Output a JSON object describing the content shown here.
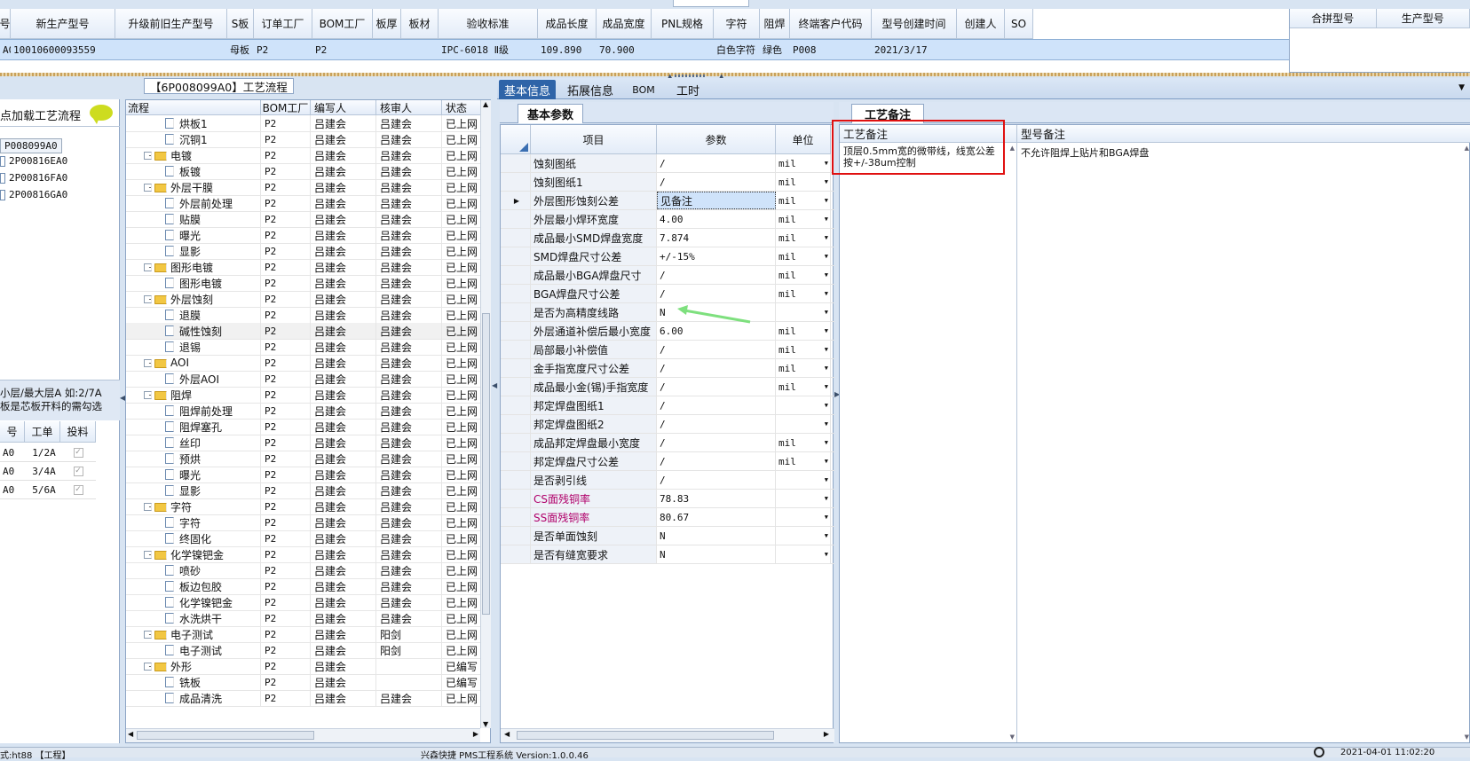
{
  "top_grid": {
    "headers": [
      "号",
      "新生产型号",
      "升级前旧生产型号",
      "S板",
      "订单工厂",
      "BOM工厂",
      "板厚",
      "板材",
      "验收标准",
      "成品长度",
      "成品宽度",
      "PNL规格",
      "字符",
      "阻焊",
      "终端客户代码",
      "型号创建时间",
      "创建人",
      "SO"
    ],
    "row": [
      "A0",
      "10010600093559",
      "",
      "母板",
      "P2",
      "P2",
      "",
      "",
      "IPC-6018 Ⅱ级",
      "109.890",
      "70.900",
      "",
      "白色字符",
      "绿色",
      "P008",
      "2021/3/17",
      "",
      ""
    ],
    "merge_headers": [
      "合拼型号",
      "生产型号"
    ]
  },
  "left_panel": {
    "load_text": "点加载工艺流程",
    "tree": [
      "P008099A0",
      "2P00816EA0",
      "2P00816FA0",
      "2P00816GA0"
    ],
    "hint_line1": "小层/最大层A 如:2/7A",
    "hint_line2": "板是芯板开料的需勾选",
    "grid_headers": [
      "号",
      "工单",
      "投料"
    ],
    "grid_rows": [
      [
        "A0",
        "1/2A"
      ],
      [
        "A0",
        "3/4A"
      ],
      [
        "A0",
        "5/6A"
      ]
    ]
  },
  "process_panel": {
    "title": "【6P008099A0】工艺流程",
    "headers": [
      "流程",
      "BOM工厂",
      "编写人",
      "核审人",
      "状态"
    ],
    "rows": [
      {
        "name": "烘板1",
        "lvl": 1,
        "f": 0,
        "bom": "P2",
        "w": "吕建会",
        "r": "吕建会",
        "s": "已上网"
      },
      {
        "name": "沉铜1",
        "lvl": 1,
        "f": 0,
        "bom": "P2",
        "w": "吕建会",
        "r": "吕建会",
        "s": "已上网"
      },
      {
        "name": "电镀",
        "lvl": 0,
        "f": 1,
        "bom": "P2",
        "w": "吕建会",
        "r": "吕建会",
        "s": "已上网"
      },
      {
        "name": "板镀",
        "lvl": 1,
        "f": 0,
        "bom": "P2",
        "w": "吕建会",
        "r": "吕建会",
        "s": "已上网"
      },
      {
        "name": "外层干膜",
        "lvl": 0,
        "f": 1,
        "bom": "P2",
        "w": "吕建会",
        "r": "吕建会",
        "s": "已上网"
      },
      {
        "name": "外层前处理",
        "lvl": 1,
        "f": 0,
        "bom": "P2",
        "w": "吕建会",
        "r": "吕建会",
        "s": "已上网"
      },
      {
        "name": "贴膜",
        "lvl": 1,
        "f": 0,
        "bom": "P2",
        "w": "吕建会",
        "r": "吕建会",
        "s": "已上网"
      },
      {
        "name": "曝光",
        "lvl": 1,
        "f": 0,
        "bom": "P2",
        "w": "吕建会",
        "r": "吕建会",
        "s": "已上网"
      },
      {
        "name": "显影",
        "lvl": 1,
        "f": 0,
        "bom": "P2",
        "w": "吕建会",
        "r": "吕建会",
        "s": "已上网"
      },
      {
        "name": "图形电镀",
        "lvl": 0,
        "f": 1,
        "bom": "P2",
        "w": "吕建会",
        "r": "吕建会",
        "s": "已上网"
      },
      {
        "name": "图形电镀",
        "lvl": 1,
        "f": 0,
        "bom": "P2",
        "w": "吕建会",
        "r": "吕建会",
        "s": "已上网"
      },
      {
        "name": "外层蚀刻",
        "lvl": 0,
        "f": 1,
        "bom": "P2",
        "w": "吕建会",
        "r": "吕建会",
        "s": "已上网"
      },
      {
        "name": "退膜",
        "lvl": 1,
        "f": 0,
        "bom": "P2",
        "w": "吕建会",
        "r": "吕建会",
        "s": "已上网"
      },
      {
        "name": "碱性蚀刻",
        "lvl": 1,
        "f": 0,
        "bom": "P2",
        "w": "吕建会",
        "r": "吕建会",
        "s": "已上网"
      },
      {
        "name": "退锡",
        "lvl": 1,
        "f": 0,
        "bom": "P2",
        "w": "吕建会",
        "r": "吕建会",
        "s": "已上网"
      },
      {
        "name": "AOI",
        "lvl": 0,
        "f": 1,
        "bom": "P2",
        "w": "吕建会",
        "r": "吕建会",
        "s": "已上网"
      },
      {
        "name": "外层AOI",
        "lvl": 1,
        "f": 0,
        "bom": "P2",
        "w": "吕建会",
        "r": "吕建会",
        "s": "已上网"
      },
      {
        "name": "阻焊",
        "lvl": 0,
        "f": 1,
        "bom": "P2",
        "w": "吕建会",
        "r": "吕建会",
        "s": "已上网"
      },
      {
        "name": "阻焊前处理",
        "lvl": 1,
        "f": 0,
        "bom": "P2",
        "w": "吕建会",
        "r": "吕建会",
        "s": "已上网"
      },
      {
        "name": "阻焊塞孔",
        "lvl": 1,
        "f": 0,
        "bom": "P2",
        "w": "吕建会",
        "r": "吕建会",
        "s": "已上网"
      },
      {
        "name": "丝印",
        "lvl": 1,
        "f": 0,
        "bom": "P2",
        "w": "吕建会",
        "r": "吕建会",
        "s": "已上网"
      },
      {
        "name": "预烘",
        "lvl": 1,
        "f": 0,
        "bom": "P2",
        "w": "吕建会",
        "r": "吕建会",
        "s": "已上网"
      },
      {
        "name": "曝光",
        "lvl": 1,
        "f": 0,
        "bom": "P2",
        "w": "吕建会",
        "r": "吕建会",
        "s": "已上网"
      },
      {
        "name": "显影",
        "lvl": 1,
        "f": 0,
        "bom": "P2",
        "w": "吕建会",
        "r": "吕建会",
        "s": "已上网"
      },
      {
        "name": "字符",
        "lvl": 0,
        "f": 1,
        "bom": "P2",
        "w": "吕建会",
        "r": "吕建会",
        "s": "已上网"
      },
      {
        "name": "字符",
        "lvl": 1,
        "f": 0,
        "bom": "P2",
        "w": "吕建会",
        "r": "吕建会",
        "s": "已上网"
      },
      {
        "name": "终固化",
        "lvl": 1,
        "f": 0,
        "bom": "P2",
        "w": "吕建会",
        "r": "吕建会",
        "s": "已上网"
      },
      {
        "name": "化学镍钯金",
        "lvl": 0,
        "f": 1,
        "bom": "P2",
        "w": "吕建会",
        "r": "吕建会",
        "s": "已上网"
      },
      {
        "name": "喷砂",
        "lvl": 1,
        "f": 0,
        "bom": "P2",
        "w": "吕建会",
        "r": "吕建会",
        "s": "已上网"
      },
      {
        "name": "板边包胶",
        "lvl": 1,
        "f": 0,
        "bom": "P2",
        "w": "吕建会",
        "r": "吕建会",
        "s": "已上网"
      },
      {
        "name": "化学镍钯金",
        "lvl": 1,
        "f": 0,
        "bom": "P2",
        "w": "吕建会",
        "r": "吕建会",
        "s": "已上网"
      },
      {
        "name": "水洗烘干",
        "lvl": 1,
        "f": 0,
        "bom": "P2",
        "w": "吕建会",
        "r": "吕建会",
        "s": "已上网"
      },
      {
        "name": "电子测试",
        "lvl": 0,
        "f": 1,
        "bom": "P2",
        "w": "吕建会",
        "r": "阳剑",
        "s": "已上网"
      },
      {
        "name": "电子测试",
        "lvl": 1,
        "f": 0,
        "bom": "P2",
        "w": "吕建会",
        "r": "阳剑",
        "s": "已上网"
      },
      {
        "name": "外形",
        "lvl": 0,
        "f": 1,
        "bom": "P2",
        "w": "吕建会",
        "r": "",
        "s": "已编写"
      },
      {
        "name": "铣板",
        "lvl": 1,
        "f": 0,
        "bom": "P2",
        "w": "吕建会",
        "r": "",
        "s": "已编写"
      },
      {
        "name": "成品清洗",
        "lvl": 1,
        "f": 0,
        "bom": "P2",
        "w": "吕建会",
        "r": "吕建会",
        "s": "已上网"
      }
    ]
  },
  "tabs": [
    "基本信息",
    "拓展信息",
    "BOM",
    "工时"
  ],
  "sub_tabs": {
    "basic": "基本参数",
    "notes": "工艺备注"
  },
  "param_grid": {
    "headers": [
      "项目",
      "参数",
      "单位"
    ],
    "rows": [
      {
        "item": "蚀刻图纸",
        "val": "/",
        "unit": "mil",
        "pink": false
      },
      {
        "item": "蚀刻图纸1",
        "val": "/",
        "unit": "mil",
        "pink": false
      },
      {
        "item": "外层图形蚀刻公差",
        "val": "见备注",
        "unit": "mil",
        "pink": false
      },
      {
        "item": "外层最小焊环宽度",
        "val": "4.00",
        "unit": "mil",
        "pink": false
      },
      {
        "item": "成品最小SMD焊盘宽度",
        "val": "7.874",
        "unit": "mil",
        "pink": false
      },
      {
        "item": "SMD焊盘尺寸公差",
        "val": "+/-15%",
        "unit": "mil",
        "pink": false
      },
      {
        "item": "成品最小BGA焊盘尺寸",
        "val": "/",
        "unit": "mil",
        "pink": false
      },
      {
        "item": "BGA焊盘尺寸公差",
        "val": "/",
        "unit": "mil",
        "pink": false
      },
      {
        "item": "是否为高精度线路",
        "val": "N",
        "unit": "",
        "pink": false
      },
      {
        "item": "外层通道补偿后最小宽度",
        "val": "6.00",
        "unit": "mil",
        "pink": false
      },
      {
        "item": "局部最小补偿值",
        "val": "/",
        "unit": "mil",
        "pink": false
      },
      {
        "item": "金手指宽度尺寸公差",
        "val": "/",
        "unit": "mil",
        "pink": false
      },
      {
        "item": "成品最小金(锡)手指宽度",
        "val": "/",
        "unit": "mil",
        "pink": false
      },
      {
        "item": "邦定焊盘图纸1",
        "val": "/",
        "unit": "",
        "pink": false
      },
      {
        "item": "邦定焊盘图纸2",
        "val": "/",
        "unit": "",
        "pink": false
      },
      {
        "item": "成品邦定焊盘最小宽度",
        "val": "/",
        "unit": "mil",
        "pink": false
      },
      {
        "item": "邦定焊盘尺寸公差",
        "val": "/",
        "unit": "mil",
        "pink": false
      },
      {
        "item": "是否剥引线",
        "val": "/",
        "unit": "",
        "pink": false
      },
      {
        "item": "CS面残铜率",
        "val": "78.83",
        "unit": "",
        "pink": true
      },
      {
        "item": "SS面残铜率",
        "val": "80.67",
        "unit": "",
        "pink": true
      },
      {
        "item": "是否单面蚀刻",
        "val": "N",
        "unit": "",
        "pink": false
      },
      {
        "item": "是否有缝宽要求",
        "val": "N",
        "unit": "",
        "pink": false
      }
    ]
  },
  "notes": {
    "process_header": "工艺备注",
    "model_header": "型号备注",
    "process_text": "顶层0.5mm宽的微带线，线宽公差按+/-38um控制",
    "model_text": "不允许阻焊上贴片和BGA焊盘"
  },
  "status_bar": {
    "left": "式:ht88 【工程】",
    "center": "兴森快捷 PMS工程系统 Version:1.0.0.46",
    "right": "2021-04-01 11:02:20"
  },
  "colors": {
    "selected_row": "#cfe3fa",
    "accent_tab": "#2f64a8",
    "pink_text": "#b0006a",
    "highlight_box": "#e01010",
    "arrow": "#7ee07e"
  }
}
